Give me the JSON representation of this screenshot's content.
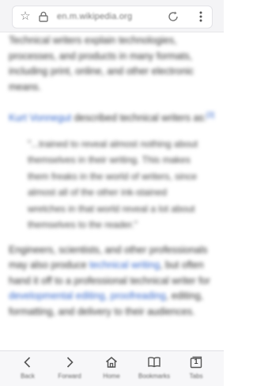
{
  "browser": {
    "url": "en.m.wikipedia.org",
    "tab_count": "1"
  },
  "article": {
    "paragraph_1": "Technical writers explain technologies, processes, and products in many formats, including print, online, and other electronic means.",
    "paragraph_2": {
      "link": "Kurt Vonnegut",
      "text": " described technical writers as:",
      "ref": "[3]"
    },
    "quote": "\"...trained to reveal almost nothing about themselves in their writing. This makes them freaks in the world of writers, since almost all of the other ink-stained wretches in that world reveal a lot about themselves to the reader.\"",
    "paragraph_3": {
      "t1": "Engineers, scientists, and other professionals may also produce ",
      "link1": "technical writing",
      "t2": ", but often hand it off to a professional technical writer for ",
      "link2": "developmental editing, proofreading",
      "t3": ", editing, formatting, and delivery to their audiences."
    }
  },
  "toolbar": {
    "back": "Back",
    "forward": "Forward",
    "home": "Home",
    "bookmarks": "Bookmarks",
    "tabs": "Tabs"
  }
}
